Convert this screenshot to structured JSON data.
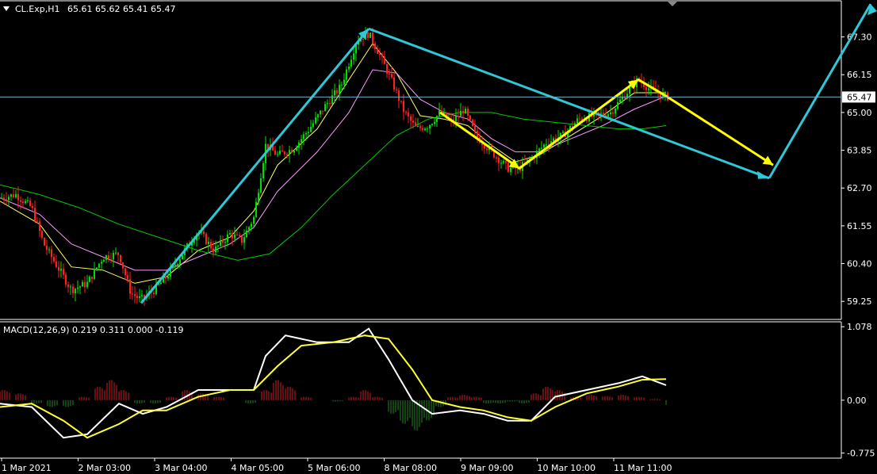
{
  "window": {
    "symbol_label": "CL.Exp,H1",
    "ohlc_label": "65.61 65.62 65.41 65.47",
    "current_price": "65.47"
  },
  "colors": {
    "background": "#000000",
    "frame": "#ffffff",
    "bull_candle": "#00e000",
    "bear_candle": "#ff2020",
    "ma_fast": "#ffff66",
    "ma_mid": "#ff99ff",
    "ma_slow": "#00cc00",
    "trend_line": "#2ec8d8",
    "projection_arrow": "#ffff00",
    "price_line": "#6fb0c8",
    "macd_line": "#ffffff",
    "signal_line": "#ffff33",
    "hist_positive": "#cc2222",
    "hist_negative": "#228822"
  },
  "chart_data": [
    {
      "type": "candlestick",
      "title": "CL.Exp,H1",
      "ylim": [
        58.7,
        68.4
      ],
      "y_ticks": [
        "67.30",
        "66.15",
        "65.00",
        "63.85",
        "62.70",
        "61.55",
        "60.40",
        "59.25"
      ],
      "x_ticks": [
        "1 Mar 2021",
        "2 Mar 03:00",
        "3 Mar 04:00",
        "4 Mar 05:00",
        "5 Mar 06:00",
        "8 Mar 08:00",
        "9 Mar 09:00",
        "10 Mar 10:00",
        "11 Mar 11:00"
      ],
      "price_path": [
        [
          0,
          62.4
        ],
        [
          20,
          62.5
        ],
        [
          40,
          62.1
        ],
        [
          55,
          61.0
        ],
        [
          70,
          60.4
        ],
        [
          90,
          59.6
        ],
        [
          110,
          59.8
        ],
        [
          130,
          60.6
        ],
        [
          150,
          60.7
        ],
        [
          165,
          59.5
        ],
        [
          178,
          59.3
        ],
        [
          195,
          59.6
        ],
        [
          210,
          60.0
        ],
        [
          230,
          60.7
        ],
        [
          250,
          61.4
        ],
        [
          270,
          60.8
        ],
        [
          290,
          61.3
        ],
        [
          305,
          61.1
        ],
        [
          320,
          61.8
        ],
        [
          335,
          64.0
        ],
        [
          350,
          63.7
        ],
        [
          370,
          63.9
        ],
        [
          390,
          64.5
        ],
        [
          410,
          65.2
        ],
        [
          430,
          65.8
        ],
        [
          450,
          67.2
        ],
        [
          465,
          67.4
        ],
        [
          480,
          66.7
        ],
        [
          495,
          65.9
        ],
        [
          510,
          65.0
        ],
        [
          525,
          64.5
        ],
        [
          540,
          64.6
        ],
        [
          555,
          65.0
        ],
        [
          570,
          64.7
        ],
        [
          585,
          65.1
        ],
        [
          600,
          64.3
        ],
        [
          620,
          63.8
        ],
        [
          640,
          63.3
        ],
        [
          655,
          63.3
        ],
        [
          670,
          63.6
        ],
        [
          690,
          64.1
        ],
        [
          710,
          64.3
        ],
        [
          730,
          64.8
        ],
        [
          750,
          64.9
        ],
        [
          770,
          65.0
        ],
        [
          790,
          65.6
        ],
        [
          805,
          66.0
        ],
        [
          820,
          65.7
        ],
        [
          840,
          65.47
        ]
      ],
      "moving_averages": [
        {
          "name": "",
          "color": "ma_fast",
          "points": [
            [
              0,
              62.3
            ],
            [
              50,
              61.6
            ],
            [
              90,
              60.3
            ],
            [
              130,
              60.2
            ],
            [
              170,
              59.8
            ],
            [
              210,
              60.0
            ],
            [
              250,
              60.8
            ],
            [
              290,
              61.2
            ],
            [
              320,
              62.0
            ],
            [
              350,
              63.4
            ],
            [
              400,
              64.5
            ],
            [
              440,
              66.0
            ],
            [
              470,
              67.1
            ],
            [
              500,
              66.2
            ],
            [
              530,
              64.9
            ],
            [
              560,
              64.8
            ],
            [
              590,
              64.6
            ],
            [
              620,
              64.0
            ],
            [
              650,
              63.5
            ],
            [
              680,
              63.7
            ],
            [
              720,
              64.3
            ],
            [
              760,
              64.9
            ],
            [
              800,
              65.6
            ],
            [
              840,
              65.6
            ]
          ]
        },
        {
          "name": "",
          "color": "ma_mid",
          "points": [
            [
              0,
              62.4
            ],
            [
              50,
              61.9
            ],
            [
              90,
              61.0
            ],
            [
              130,
              60.6
            ],
            [
              170,
              60.2
            ],
            [
              210,
              60.2
            ],
            [
              250,
              60.6
            ],
            [
              290,
              61.0
            ],
            [
              320,
              61.5
            ],
            [
              350,
              62.6
            ],
            [
              400,
              63.8
            ],
            [
              440,
              65.0
            ],
            [
              470,
              66.3
            ],
            [
              500,
              66.2
            ],
            [
              530,
              65.4
            ],
            [
              560,
              65.0
            ],
            [
              590,
              64.8
            ],
            [
              620,
              64.2
            ],
            [
              650,
              63.8
            ],
            [
              680,
              63.8
            ],
            [
              720,
              64.2
            ],
            [
              760,
              64.6
            ],
            [
              800,
              65.1
            ],
            [
              840,
              65.5
            ]
          ]
        },
        {
          "name": "",
          "color": "ma_slow",
          "points": [
            [
              0,
              62.8
            ],
            [
              50,
              62.5
            ],
            [
              100,
              62.1
            ],
            [
              150,
              61.6
            ],
            [
              200,
              61.2
            ],
            [
              250,
              60.8
            ],
            [
              300,
              60.5
            ],
            [
              340,
              60.7
            ],
            [
              380,
              61.5
            ],
            [
              420,
              62.5
            ],
            [
              460,
              63.4
            ],
            [
              500,
              64.3
            ],
            [
              540,
              64.8
            ],
            [
              580,
              65.0
            ],
            [
              620,
              65.0
            ],
            [
              660,
              64.8
            ],
            [
              700,
              64.7
            ],
            [
              740,
              64.6
            ],
            [
              780,
              64.5
            ],
            [
              810,
              64.5
            ],
            [
              840,
              64.6
            ]
          ]
        }
      ],
      "annotations": {
        "trend_lines": [
          [
            [
              178,
              59.2
            ],
            [
              465,
              67.55
            ]
          ],
          [
            [
              465,
              67.55
            ],
            [
              970,
              63.0
            ]
          ],
          [
            [
              970,
              63.0
            ],
            [
              1098,
              68.3
            ]
          ]
        ],
        "projection_path": [
          [
            555,
            65.0
          ],
          [
            655,
            63.3
          ],
          [
            805,
            66.0
          ],
          [
            840,
            65.5
          ],
          [
            975,
            63.4
          ]
        ]
      }
    },
    {
      "type": "line",
      "title": "MACD(12,26,9) 0.219 0.311 0.000 -0.119",
      "ylim": [
        -0.85,
        1.15
      ],
      "y_ticks": [
        "1.078",
        "0.00",
        "-0.775"
      ],
      "series": [
        {
          "name": "",
          "color": "macd_line",
          "points": [
            [
              0,
              -0.05
            ],
            [
              40,
              -0.1
            ],
            [
              80,
              -0.55
            ],
            [
              110,
              -0.5
            ],
            [
              150,
              -0.05
            ],
            [
              180,
              -0.2
            ],
            [
              210,
              -0.1
            ],
            [
              250,
              0.15
            ],
            [
              290,
              0.15
            ],
            [
              320,
              0.15
            ],
            [
              335,
              0.65
            ],
            [
              360,
              0.95
            ],
            [
              400,
              0.85
            ],
            [
              440,
              0.85
            ],
            [
              465,
              1.05
            ],
            [
              490,
              0.6
            ],
            [
              520,
              0.0
            ],
            [
              545,
              -0.2
            ],
            [
              580,
              -0.15
            ],
            [
              610,
              -0.2
            ],
            [
              640,
              -0.3
            ],
            [
              670,
              -0.3
            ],
            [
              700,
              0.05
            ],
            [
              740,
              0.15
            ],
            [
              780,
              0.25
            ],
            [
              810,
              0.35
            ],
            [
              840,
              0.22
            ]
          ]
        },
        {
          "name": "",
          "color": "signal_line",
          "points": [
            [
              0,
              -0.1
            ],
            [
              40,
              -0.05
            ],
            [
              80,
              -0.3
            ],
            [
              110,
              -0.55
            ],
            [
              150,
              -0.35
            ],
            [
              180,
              -0.15
            ],
            [
              210,
              -0.15
            ],
            [
              250,
              0.05
            ],
            [
              290,
              0.15
            ],
            [
              320,
              0.15
            ],
            [
              350,
              0.5
            ],
            [
              380,
              0.8
            ],
            [
              420,
              0.85
            ],
            [
              460,
              0.95
            ],
            [
              490,
              0.9
            ],
            [
              520,
              0.45
            ],
            [
              545,
              0.0
            ],
            [
              580,
              -0.1
            ],
            [
              610,
              -0.15
            ],
            [
              640,
              -0.25
            ],
            [
              670,
              -0.3
            ],
            [
              700,
              -0.1
            ],
            [
              740,
              0.1
            ],
            [
              780,
              0.2
            ],
            [
              810,
              0.3
            ],
            [
              840,
              0.31
            ]
          ]
        }
      ],
      "histogram": [
        [
          0,
          0.15
        ],
        [
          20,
          0.1
        ],
        [
          40,
          -0.05
        ],
        [
          60,
          -0.1
        ],
        [
          80,
          -0.1
        ],
        [
          100,
          0.05
        ],
        [
          120,
          0.2
        ],
        [
          135,
          0.3
        ],
        [
          150,
          0.15
        ],
        [
          170,
          -0.05
        ],
        [
          190,
          -0.05
        ],
        [
          210,
          0.05
        ],
        [
          230,
          0.15
        ],
        [
          250,
          0.1
        ],
        [
          270,
          0.05
        ],
        [
          290,
          0.0
        ],
        [
          310,
          -0.05
        ],
        [
          330,
          0.15
        ],
        [
          345,
          0.3
        ],
        [
          360,
          0.2
        ],
        [
          380,
          0.05
        ],
        [
          400,
          0.0
        ],
        [
          420,
          -0.02
        ],
        [
          440,
          0.05
        ],
        [
          455,
          0.15
        ],
        [
          470,
          0.05
        ],
        [
          490,
          -0.2
        ],
        [
          505,
          -0.35
        ],
        [
          520,
          -0.45
        ],
        [
          535,
          -0.3
        ],
        [
          550,
          -0.1
        ],
        [
          565,
          0.05
        ],
        [
          580,
          0.08
        ],
        [
          595,
          0.05
        ],
        [
          610,
          -0.05
        ],
        [
          625,
          -0.05
        ],
        [
          640,
          -0.02
        ],
        [
          655,
          -0.05
        ],
        [
          670,
          0.1
        ],
        [
          685,
          0.2
        ],
        [
          700,
          0.15
        ],
        [
          720,
          0.05
        ],
        [
          740,
          0.08
        ],
        [
          760,
          0.06
        ],
        [
          780,
          0.08
        ],
        [
          800,
          0.05
        ],
        [
          820,
          0.02
        ],
        [
          840,
          -0.08
        ]
      ]
    }
  ]
}
